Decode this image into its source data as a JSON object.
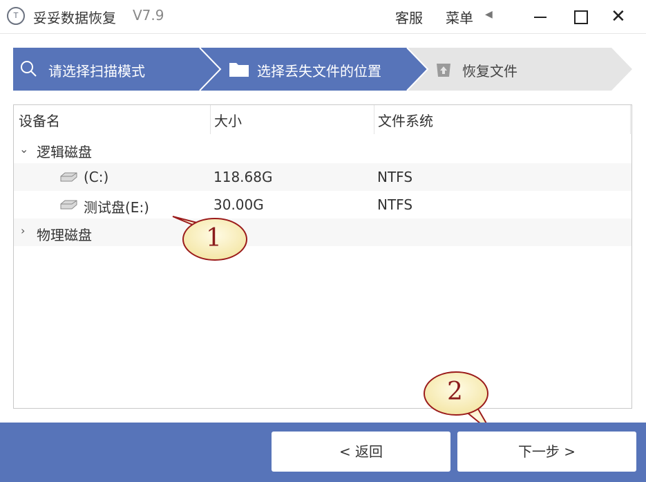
{
  "app": {
    "logo_text": "T",
    "title": "妥妥数据恢复",
    "version": "V7.9",
    "service": "客服",
    "menu": "菜单"
  },
  "steps": [
    {
      "label": "请选择扫描模式",
      "icon": "search-icon"
    },
    {
      "label": "选择丢失文件的位置",
      "icon": "folder-icon"
    },
    {
      "label": "恢复文件",
      "icon": "upload-icon"
    }
  ],
  "table": {
    "columns": [
      "设备名",
      "大小",
      "文件系统"
    ],
    "groups": [
      {
        "label": "逻辑磁盘",
        "expanded": true,
        "items": [
          {
            "name": "(C:)",
            "size": "118.68G",
            "fs": "NTFS"
          },
          {
            "name": "测试盘(E:)",
            "size": "30.00G",
            "fs": "NTFS"
          }
        ]
      },
      {
        "label": "物理磁盘",
        "expanded": false,
        "items": []
      }
    ]
  },
  "callouts": [
    "1",
    "2"
  ],
  "buttons": {
    "back": "< 返回",
    "next": "下一步 >"
  },
  "colors": {
    "accent": "#5774b9",
    "step_inactive": "#e5e5e5"
  }
}
